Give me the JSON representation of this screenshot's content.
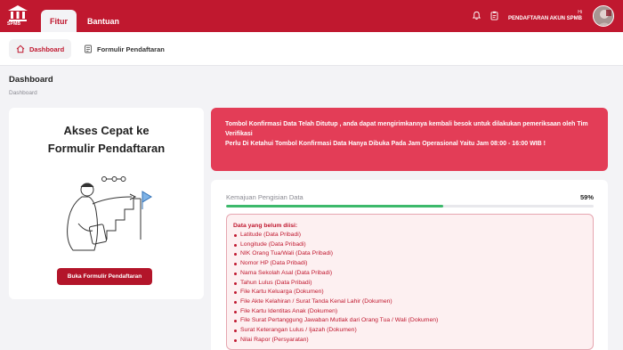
{
  "app": {
    "logo_text": "SPMB",
    "brand_color": "#c0182f"
  },
  "header": {
    "tabs": [
      {
        "label": "Fitur",
        "active": true
      },
      {
        "label": "Bantuan",
        "active": false
      }
    ],
    "icons": [
      "bell-icon",
      "clipboard-icon"
    ],
    "greeting": "Hi",
    "username": "PENDAFTARAN AKUN SPMB"
  },
  "subnav": {
    "items": [
      {
        "label": "Dashboard",
        "icon": "home-icon",
        "active": true
      },
      {
        "label": "Formulir Pendaftaran",
        "icon": "form-icon",
        "active": false
      }
    ]
  },
  "page": {
    "title": "Dashboard",
    "breadcrumb": "Dashboard"
  },
  "quick_access": {
    "title_line1": "Akses Cepat ke",
    "title_line2": "Formulir Pendaftaran",
    "button_label": "Buka Formulir Pendaftaran"
  },
  "alert": {
    "line1": "Tombol Konfirmasi Data Telah Ditutup , anda dapat mengirimkannya kembali besok untuk dilakukan pemeriksaan oleh Tim Verifikasi",
    "line2": "Perlu Di Ketahui Tombol Konfirmasi Data Hanya Dibuka Pada Jam Operasional Yaitu Jam 08:00 - 16:00 WIB !"
  },
  "progress": {
    "label": "Kemajuan Pengisian Data",
    "percent_text": "59%",
    "fill_fraction": 0.59,
    "missing_title": "Data yang belum diisi:",
    "missing_items": [
      "Latitude (Data Pribadi)",
      "Longitude (Data Pribadi)",
      "NIK Orang Tua/Wali (Data Pribadi)",
      "Nomor HP (Data Pribadi)",
      "Nama Sekolah Asal (Data Pribadi)",
      "Tahun Lulus (Data Pribadi)",
      "File Kartu Keluarga (Dokumen)",
      "File Akte Kelahiran / Surat Tanda Kenal Lahir (Dokumen)",
      "File Kartu Identitas Anak (Dokumen)",
      "File Surat Pertanggung Jawaban Mutlak dari Orang Tua / Wali (Dokumen)",
      "Surat Keterangan Lulus / Ijazah (Dokumen)",
      "Nilai Rapor (Persyaratan)"
    ]
  }
}
